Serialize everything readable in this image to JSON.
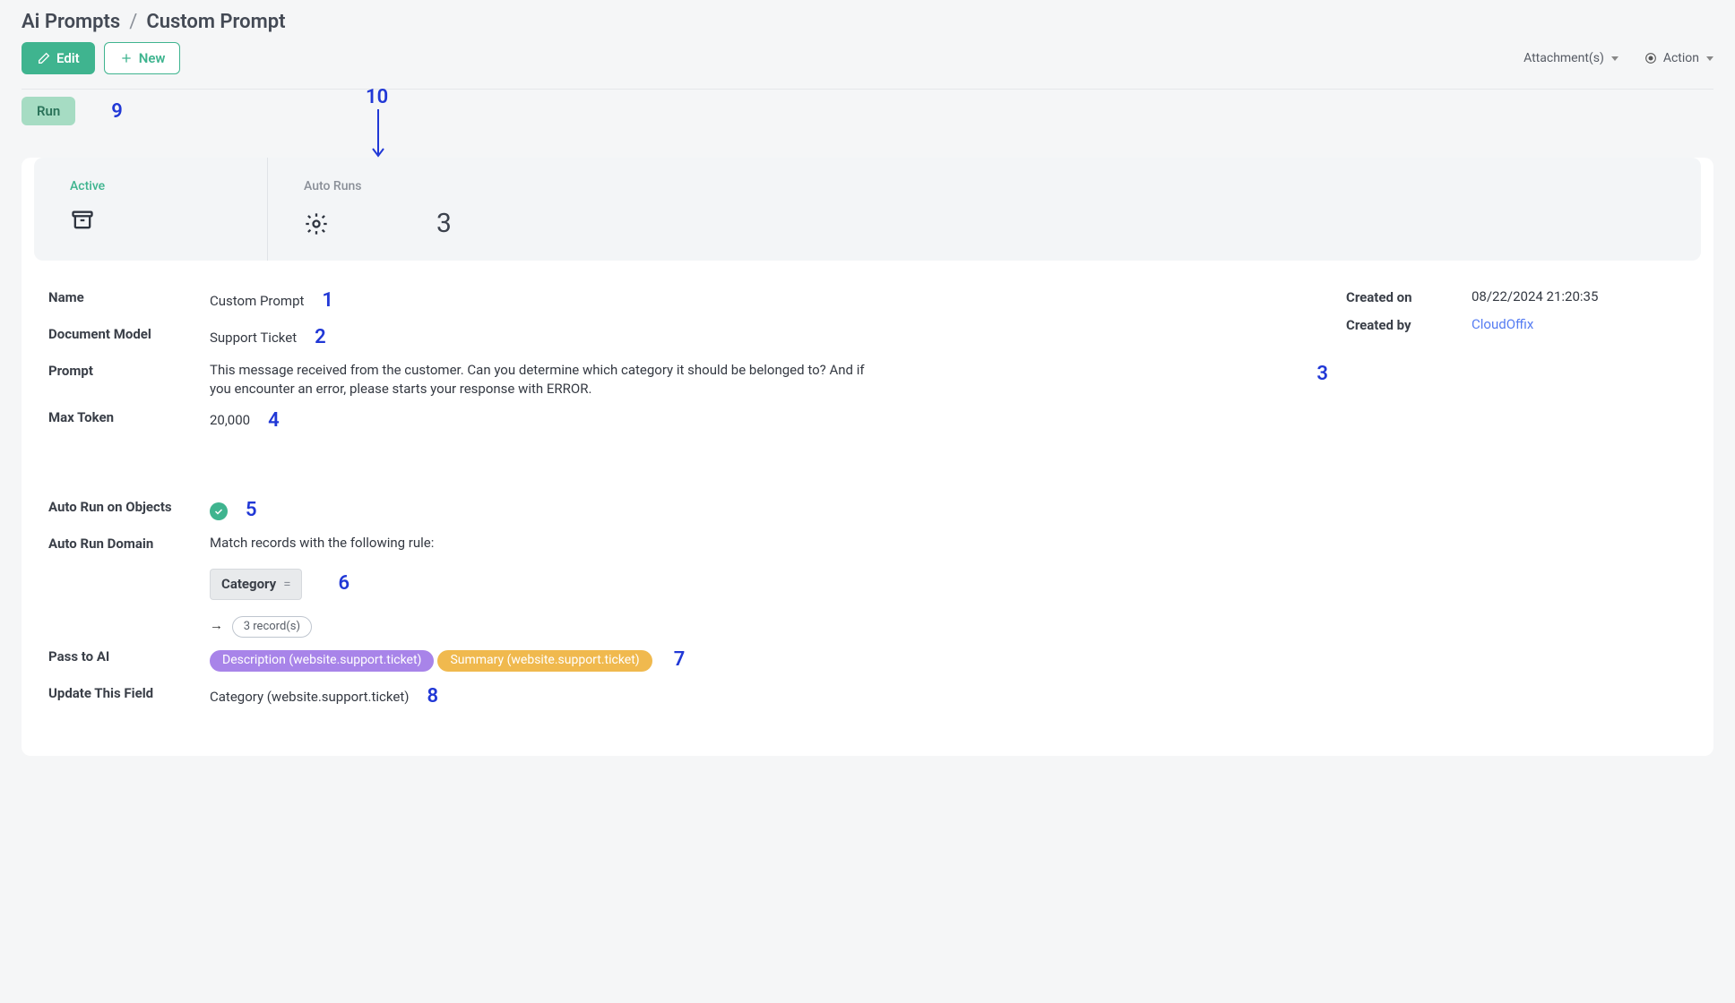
{
  "breadcrumb": {
    "root": "Ai Prompts",
    "sep": "/",
    "current": "Custom Prompt"
  },
  "toolbar": {
    "edit": "Edit",
    "new": "New",
    "attachments": "Attachment(s)",
    "action": "Action"
  },
  "runbar": {
    "run": "Run"
  },
  "annotations": {
    "a1": "1",
    "a2": "2",
    "a3": "3",
    "a4": "4",
    "a5": "5",
    "a6": "6",
    "a7": "7",
    "a8": "8",
    "a9": "9",
    "a10": "10"
  },
  "kpi": {
    "active": {
      "title": "Active"
    },
    "autoruns": {
      "title": "Auto Runs",
      "value": "3"
    }
  },
  "fields": {
    "name": {
      "label": "Name",
      "value": "Custom Prompt"
    },
    "model": {
      "label": "Document Model",
      "value": "Support Ticket"
    },
    "prompt": {
      "label": "Prompt",
      "value": "This message received from the customer. Can you determine which category it should be belonged to? And if you encounter an error, please starts your response with ERROR."
    },
    "maxtoken": {
      "label": "Max Token",
      "value": "20,000"
    },
    "autorun_obj": {
      "label": "Auto Run on Objects"
    },
    "autorun_domain": {
      "label": "Auto Run Domain",
      "intro": "Match records with the following rule:"
    },
    "domain_chip": {
      "field": "Category",
      "op": "="
    },
    "records": "3 record(s)",
    "pass_to_ai": {
      "label": "Pass to AI",
      "tags": [
        {
          "text": "Description (website.support.ticket)",
          "color": "tag-purple"
        },
        {
          "text": "Summary (website.support.ticket)",
          "color": "tag-orange"
        }
      ]
    },
    "update_field": {
      "label": "Update This Field",
      "value": "Category (website.support.ticket)"
    },
    "created_on": {
      "label": "Created on",
      "value": "08/22/2024 21:20:35"
    },
    "created_by": {
      "label": "Created by",
      "value": "CloudOffix"
    }
  }
}
